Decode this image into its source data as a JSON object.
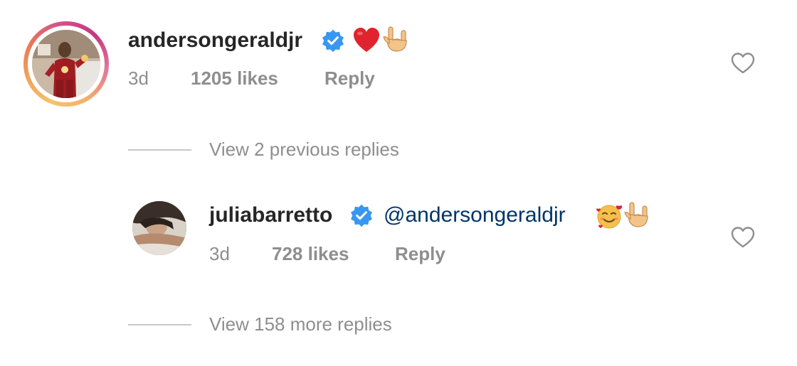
{
  "comments": [
    {
      "username": "andersongeraldjr",
      "verified": true,
      "text": "",
      "emojis": [
        "red-heart",
        "sign-of-horns"
      ],
      "time": "3d",
      "likes": "1205 likes",
      "reply_label": "Reply",
      "avatar_ring": true
    },
    {
      "username": "juliabarretto",
      "verified": true,
      "text": "@andersongeraldjr",
      "emojis": [
        "smiling-face-with-hearts",
        "sign-of-horns"
      ],
      "time": "3d",
      "likes": "728 likes",
      "reply_label": "Reply",
      "avatar_ring": false
    }
  ],
  "view_previous": "View 2 previous replies",
  "view_more": "View 158 more replies",
  "colors": {
    "verified_badge": "#3897f0",
    "meta_text": "#8e8e8e",
    "username": "#262626",
    "mention": "#003569",
    "heart": "#e0242f"
  },
  "icons": {
    "verified": "verified-badge-icon",
    "like": "heart-outline-icon"
  }
}
